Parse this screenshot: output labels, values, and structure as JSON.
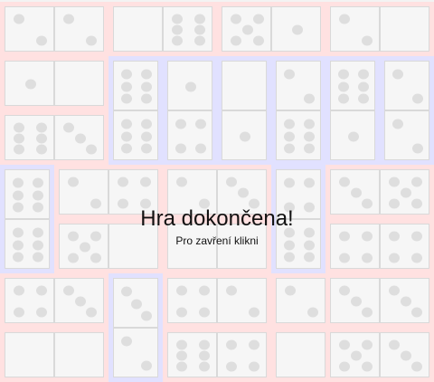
{
  "overlay": {
    "title": "Hra dokončena!",
    "hint": "Pro zavření klikni"
  },
  "colors": {
    "red_frame": "#ffe1e1",
    "blue_frame": "#e1e1ff",
    "pip": "#dedede",
    "tile_face": "#f6f6f6"
  },
  "board": {
    "rows": 7,
    "cols": 8,
    "dominoes": [
      {
        "orientation": "horizontal",
        "row": 0,
        "col": 0,
        "pips": [
          2,
          2
        ],
        "frame": "red"
      },
      {
        "orientation": "horizontal",
        "row": 0,
        "col": 2,
        "pips": [
          0,
          6
        ],
        "frame": "red"
      },
      {
        "orientation": "horizontal",
        "row": 0,
        "col": 4,
        "pips": [
          5,
          1
        ],
        "frame": "red"
      },
      {
        "orientation": "horizontal",
        "row": 0,
        "col": 6,
        "pips": [
          2,
          0
        ],
        "frame": "red"
      },
      {
        "orientation": "horizontal",
        "row": 1,
        "col": 0,
        "pips": [
          1,
          0
        ],
        "frame": "red"
      },
      {
        "orientation": "vertical",
        "row": 1,
        "col": 2,
        "pips": [
          6,
          6
        ],
        "frame": "blue"
      },
      {
        "orientation": "vertical",
        "row": 1,
        "col": 3,
        "pips": [
          1,
          4
        ],
        "frame": "blue"
      },
      {
        "orientation": "vertical",
        "row": 1,
        "col": 4,
        "pips": [
          0,
          1
        ],
        "frame": "blue"
      },
      {
        "orientation": "vertical",
        "row": 1,
        "col": 5,
        "pips": [
          2,
          6
        ],
        "frame": "blue"
      },
      {
        "orientation": "vertical",
        "row": 1,
        "col": 6,
        "pips": [
          6,
          1
        ],
        "frame": "blue"
      },
      {
        "orientation": "vertical",
        "row": 1,
        "col": 7,
        "pips": [
          2,
          2
        ],
        "frame": "blue"
      },
      {
        "orientation": "horizontal",
        "row": 2,
        "col": 0,
        "pips": [
          6,
          3
        ],
        "frame": "red"
      },
      {
        "orientation": "vertical",
        "row": 3,
        "col": 0,
        "pips": [
          6,
          6
        ],
        "frame": "blue"
      },
      {
        "orientation": "horizontal",
        "row": 3,
        "col": 1,
        "pips": [
          2,
          4
        ],
        "frame": "red"
      },
      {
        "orientation": "horizontal",
        "row": 3,
        "col": 3,
        "pips": [
          2,
          3
        ],
        "frame": "red"
      },
      {
        "orientation": "vertical",
        "row": 3,
        "col": 5,
        "pips": [
          4,
          6
        ],
        "frame": "blue"
      },
      {
        "orientation": "horizontal",
        "row": 3,
        "col": 6,
        "pips": [
          3,
          5
        ],
        "frame": "red"
      },
      {
        "orientation": "horizontal",
        "row": 4,
        "col": 1,
        "pips": [
          5,
          0
        ],
        "frame": "red"
      },
      {
        "orientation": "horizontal",
        "row": 4,
        "col": 3,
        "pips": [
          0,
          0
        ],
        "frame": "red"
      },
      {
        "orientation": "horizontal",
        "row": 4,
        "col": 6,
        "pips": [
          4,
          4
        ],
        "frame": "red"
      },
      {
        "orientation": "horizontal",
        "row": 5,
        "col": 0,
        "pips": [
          4,
          3
        ],
        "frame": "red"
      },
      {
        "orientation": "vertical",
        "row": 5,
        "col": 2,
        "pips": [
          3,
          2
        ],
        "frame": "blue"
      },
      {
        "orientation": "horizontal",
        "row": 5,
        "col": 3,
        "pips": [
          4,
          2
        ],
        "frame": "red"
      },
      {
        "orientation": "horizontal",
        "row": 5,
        "col": 5,
        "pips": [
          2,
          5
        ],
        "frame": "red"
      },
      {
        "orientation": "horizontal",
        "row": 5,
        "col": 6,
        "pips": [
          3,
          3
        ],
        "frame": "red"
      },
      {
        "orientation": "horizontal",
        "row": 6,
        "col": 0,
        "pips": [
          0,
          0
        ],
        "frame": "red"
      },
      {
        "orientation": "horizontal",
        "row": 6,
        "col": 3,
        "pips": [
          6,
          4
        ],
        "frame": "red"
      },
      {
        "orientation": "horizontal",
        "row": 6,
        "col": 5,
        "pips": [
          0,
          1
        ],
        "frame": "red"
      },
      {
        "orientation": "horizontal",
        "row": 6,
        "col": 6,
        "pips": [
          5,
          3
        ],
        "frame": "red"
      }
    ]
  }
}
